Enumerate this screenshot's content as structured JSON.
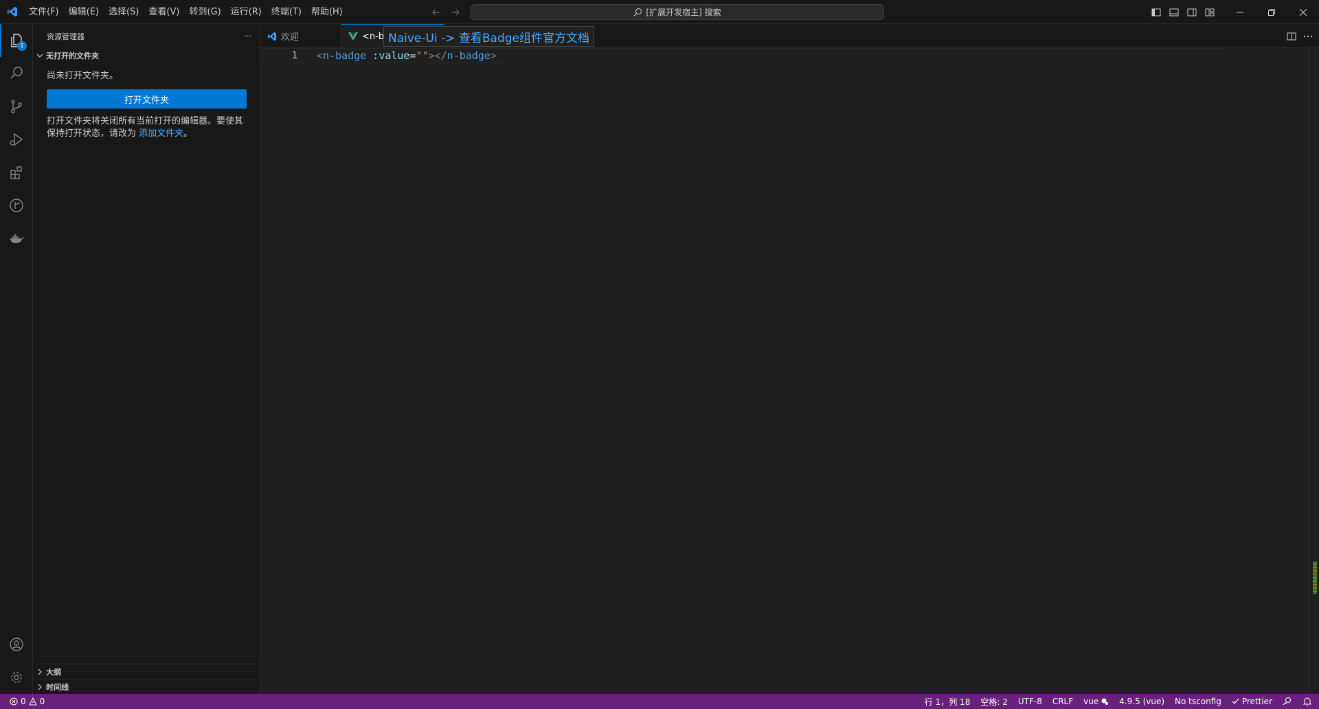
{
  "titlebar": {
    "menu": [
      "文件(F)",
      "编辑(E)",
      "选择(S)",
      "查看(V)",
      "转到(G)",
      "运行(R)",
      "终端(T)",
      "帮助(H)"
    ],
    "search_text": "[扩展开发宿主] 搜索"
  },
  "activitybar": {
    "explorer_badge": "1"
  },
  "sidebar": {
    "title": "资源管理器",
    "more": "···",
    "section_title": "无打开的文件夹",
    "no_folder_text": "尚未打开文件夹。",
    "open_folder_button": "打开文件夹",
    "hint_text": "打开文件夹将关闭所有当前打开的编辑器。要使其保持打开状态，请改为 ",
    "hint_link": "添加文件夹",
    "hint_end": "。",
    "outline_label": "大纲",
    "timeline_label": "时间线"
  },
  "tabs": [
    {
      "label": "欢迎",
      "icon": "vscode-icon"
    },
    {
      "label": "<n-b",
      "icon": "vue-icon"
    }
  ],
  "tooltip": "Naive-Ui -> 查看Badge组件官方文档",
  "editor": {
    "line_number": "1",
    "tokens": {
      "open_bracket": "<",
      "tag": "n-badge",
      "space": " ",
      "attr": ":value",
      "equals": "=",
      "string": "\"\"",
      "close_open": "></",
      "close_tag": "n-badge",
      "close_bracket": ">"
    }
  },
  "statusbar": {
    "errors": "0",
    "warnings": "0",
    "position": "行 1，列 18",
    "spaces": "空格: 2",
    "encoding": "UTF-8",
    "eol": "CRLF",
    "language": "vue",
    "version": "4.9.5 (vue)",
    "tsconfig": "No tsconfig",
    "prettier": "Prettier"
  },
  "colors": {
    "accent": "#0078d4",
    "statusbar_bg": "#68217a",
    "link": "#4daafc",
    "vue_green": "#41b883"
  }
}
